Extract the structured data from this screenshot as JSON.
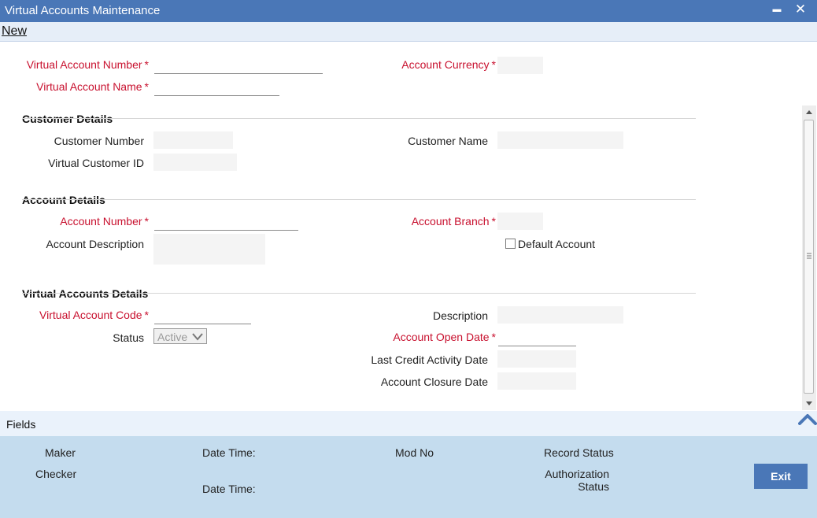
{
  "window": {
    "title": "Virtual Accounts Maintenance",
    "minimize_glyph": "▬",
    "close_glyph": "✕"
  },
  "menu": {
    "new_label": "New"
  },
  "header_fields": {
    "virtual_account_number": {
      "label": "Virtual Account Number",
      "value": ""
    },
    "virtual_account_name": {
      "label": "Virtual Account Name",
      "value": ""
    },
    "account_currency": {
      "label": "Account Currency",
      "value": ""
    }
  },
  "customer_details": {
    "title": "Customer Details",
    "customer_number": {
      "label": "Customer Number",
      "value": ""
    },
    "virtual_customer_id": {
      "label": "Virtual Customer ID",
      "value": ""
    },
    "customer_name": {
      "label": "Customer Name",
      "value": ""
    }
  },
  "account_details": {
    "title": "Account Details",
    "account_number": {
      "label": "Account Number",
      "value": ""
    },
    "account_description": {
      "label": "Account Description",
      "value": ""
    },
    "account_branch": {
      "label": "Account Branch",
      "value": ""
    },
    "default_account": {
      "label": "Default Account",
      "checked": false
    }
  },
  "virtual_accounts_details": {
    "title": "Virtual Accounts Details",
    "virtual_account_code": {
      "label": "Virtual Account Code",
      "value": ""
    },
    "status": {
      "label": "Status",
      "selected": "Active"
    },
    "description": {
      "label": "Description",
      "value": ""
    },
    "account_open_date": {
      "label": "Account Open Date",
      "value": ""
    },
    "last_credit_activity_date": {
      "label": "Last Credit Activity Date",
      "value": ""
    },
    "account_closure_date": {
      "label": "Account Closure Date",
      "value": ""
    }
  },
  "required_marker": "*",
  "fields_bar": {
    "label": "Fields"
  },
  "audit": {
    "maker_label": "Maker",
    "checker_label": "Checker",
    "date_time_label": "Date Time:",
    "mod_no_label": "Mod No",
    "record_status_label": "Record Status",
    "authorization_label": "Authorization",
    "status_label": "Status",
    "exit_label": "Exit"
  },
  "colors": {
    "title_bar": "#4a77b7",
    "required_label": "#c8102e",
    "footer": "#c4dcee"
  }
}
